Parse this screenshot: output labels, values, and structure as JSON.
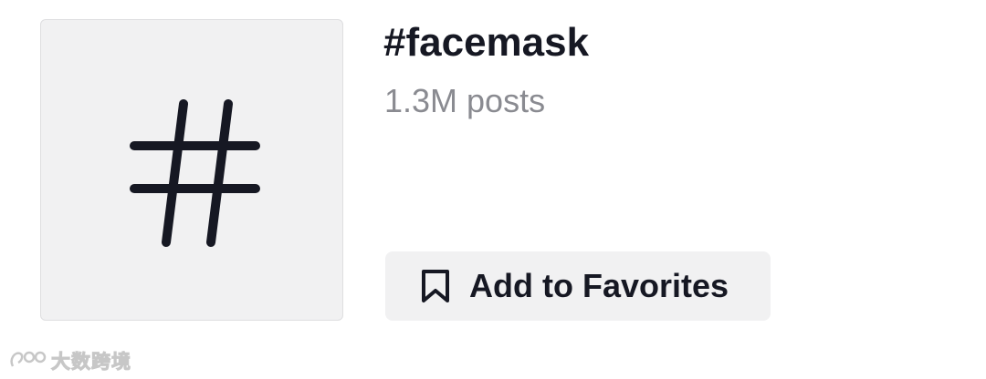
{
  "hashtag": {
    "thumbnail_icon": "hash-icon",
    "title": "#facemask",
    "post_count": "1.3M posts"
  },
  "favorites_button": {
    "icon": "bookmark-icon",
    "label": "Add to Favorites"
  },
  "watermark": {
    "text": "大数跨境"
  },
  "colors": {
    "text_primary": "#161823",
    "text_secondary": "#8a8b91",
    "surface": "#f1f1f2"
  }
}
